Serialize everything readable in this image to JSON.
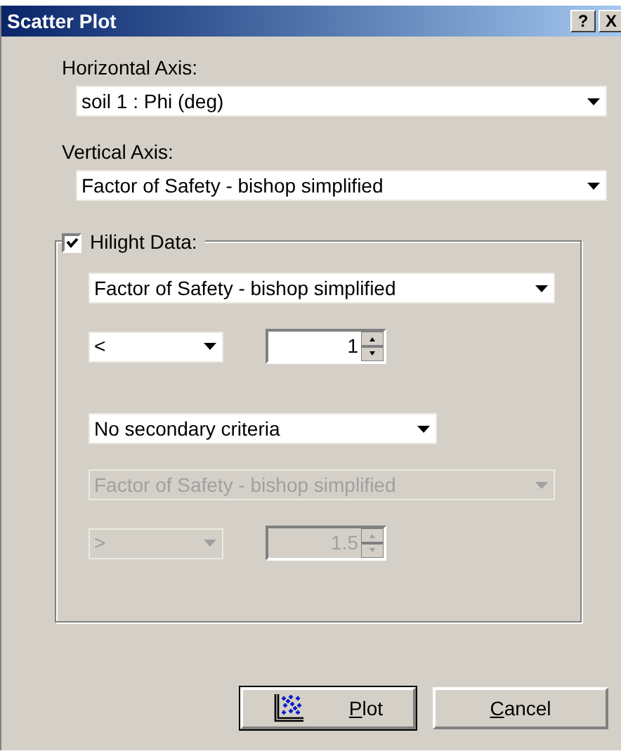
{
  "window": {
    "title": "Scatter Plot",
    "title_buttons": [
      "?",
      "X"
    ]
  },
  "horizontal_axis": {
    "label": "Horizontal Axis:",
    "value": "soil 1 : Phi (deg)"
  },
  "vertical_axis": {
    "label": "Vertical Axis:",
    "value": "Factor of Safety - bishop simplified"
  },
  "highlight": {
    "label": "Hilight Data:",
    "checked": true,
    "primary": {
      "field": {
        "value": "Factor of Safety - bishop simplified",
        "disabled": false
      },
      "operator": {
        "value": "<",
        "disabled": false
      },
      "threshold": {
        "value": "1",
        "disabled": false
      }
    },
    "secondary_mode": {
      "value": "No secondary criteria",
      "disabled": false
    },
    "secondary": {
      "field": {
        "value": "Factor of Safety - bishop simplified",
        "disabled": true
      },
      "operator": {
        "value": ">",
        "disabled": true
      },
      "threshold": {
        "value": "1.5",
        "disabled": true
      }
    }
  },
  "buttons": [
    {
      "kind": "plot",
      "label": "Plot",
      "default": true
    },
    {
      "kind": "cancel",
      "label": "Cancel",
      "default": false
    }
  ]
}
